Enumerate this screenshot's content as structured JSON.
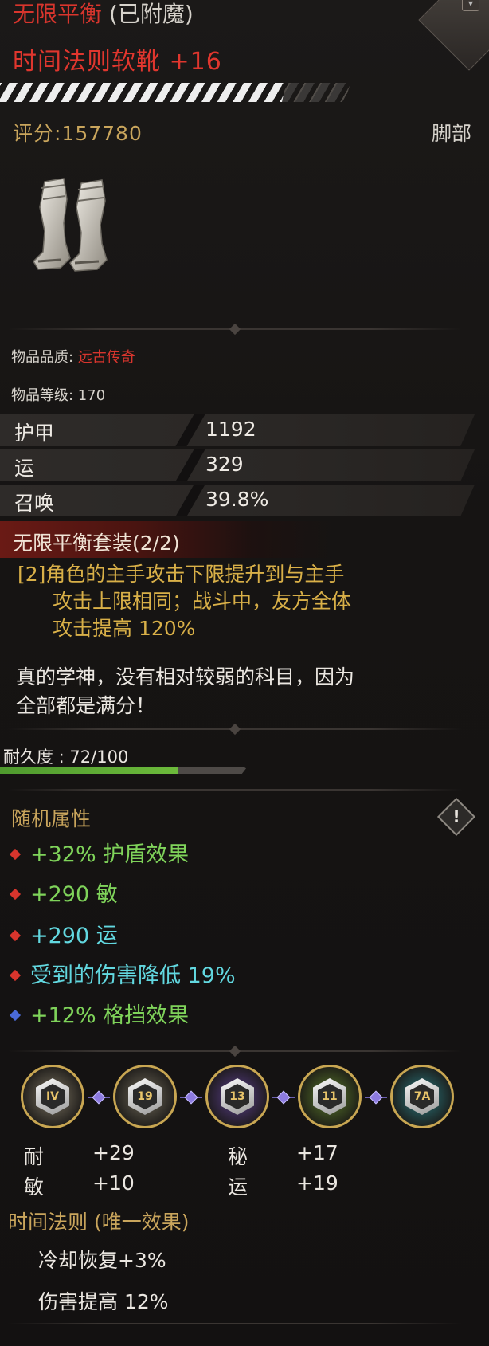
{
  "header": {
    "set_name": "无限平衡",
    "enchant_tag": "(已附魔)",
    "item_name": "时间法则软靴 +16",
    "score": "评分:157780",
    "slot": "脚部",
    "corner_icon": "scroll-down-icon"
  },
  "info": {
    "quality_label": "物品品质: ",
    "quality_value": "远古传奇",
    "level": "物品等级: 170"
  },
  "stats": [
    {
      "name": "护甲",
      "value": "1192"
    },
    {
      "name": "运",
      "value": "329"
    },
    {
      "name": "召唤",
      "value": "39.8%"
    }
  ],
  "set_bonus": {
    "title": "无限平衡套装(2/2)",
    "line1": "[2]角色的主手攻击下限提升到与主手",
    "line2": "攻击上限相同；战斗中，友方全体",
    "line3": "攻击提高 120%"
  },
  "flavor": {
    "line1": "真的学神，没有相对较弱的科目，因为",
    "line2": "全部都是满分！"
  },
  "durability": {
    "label": "耐久度 : 72/100",
    "current": 72,
    "max": 100
  },
  "random_attrs": {
    "title": "随机属性",
    "items": [
      {
        "text": "+32% 护盾效果",
        "color": "#7fd35a",
        "gem": "#d8352d"
      },
      {
        "text": "+290 敏",
        "color": "#7fd35a",
        "gem": "#d8352d"
      },
      {
        "text": "+290 运",
        "color": "#62d8e0",
        "gem": "#d8352d"
      },
      {
        "text": "受到的伤害降低 19%",
        "color": "#62d8e0",
        "gem": "#d8352d"
      },
      {
        "text": "+12% 格挡效果",
        "color": "#7fd35a",
        "gem": "#4a6ad8"
      }
    ]
  },
  "sockets": {
    "gems": [
      {
        "glyph": "IV",
        "ring": "#7a7260",
        "icon": "gem-silver-icon"
      },
      {
        "glyph": "19",
        "ring": "#6e6858",
        "icon": "gem-silver-icon"
      },
      {
        "glyph": "13",
        "ring": "#5a3e8c",
        "icon": "gem-purple-icon"
      },
      {
        "glyph": "11",
        "ring": "#5a7a2a",
        "icon": "gem-green-icon"
      },
      {
        "glyph": "7A",
        "ring": "#2a7a80",
        "icon": "gem-teal-icon"
      }
    ],
    "stats": [
      {
        "name": "耐",
        "value": "+29"
      },
      {
        "name": "秘",
        "value": "+17"
      },
      {
        "name": "敏",
        "value": "+10"
      },
      {
        "name": "运",
        "value": "+19"
      }
    ]
  },
  "time_law": {
    "title": "时间法则 (唯一效果)",
    "lines": [
      "冷却恢复+3%",
      "伤害提高 12%"
    ]
  }
}
